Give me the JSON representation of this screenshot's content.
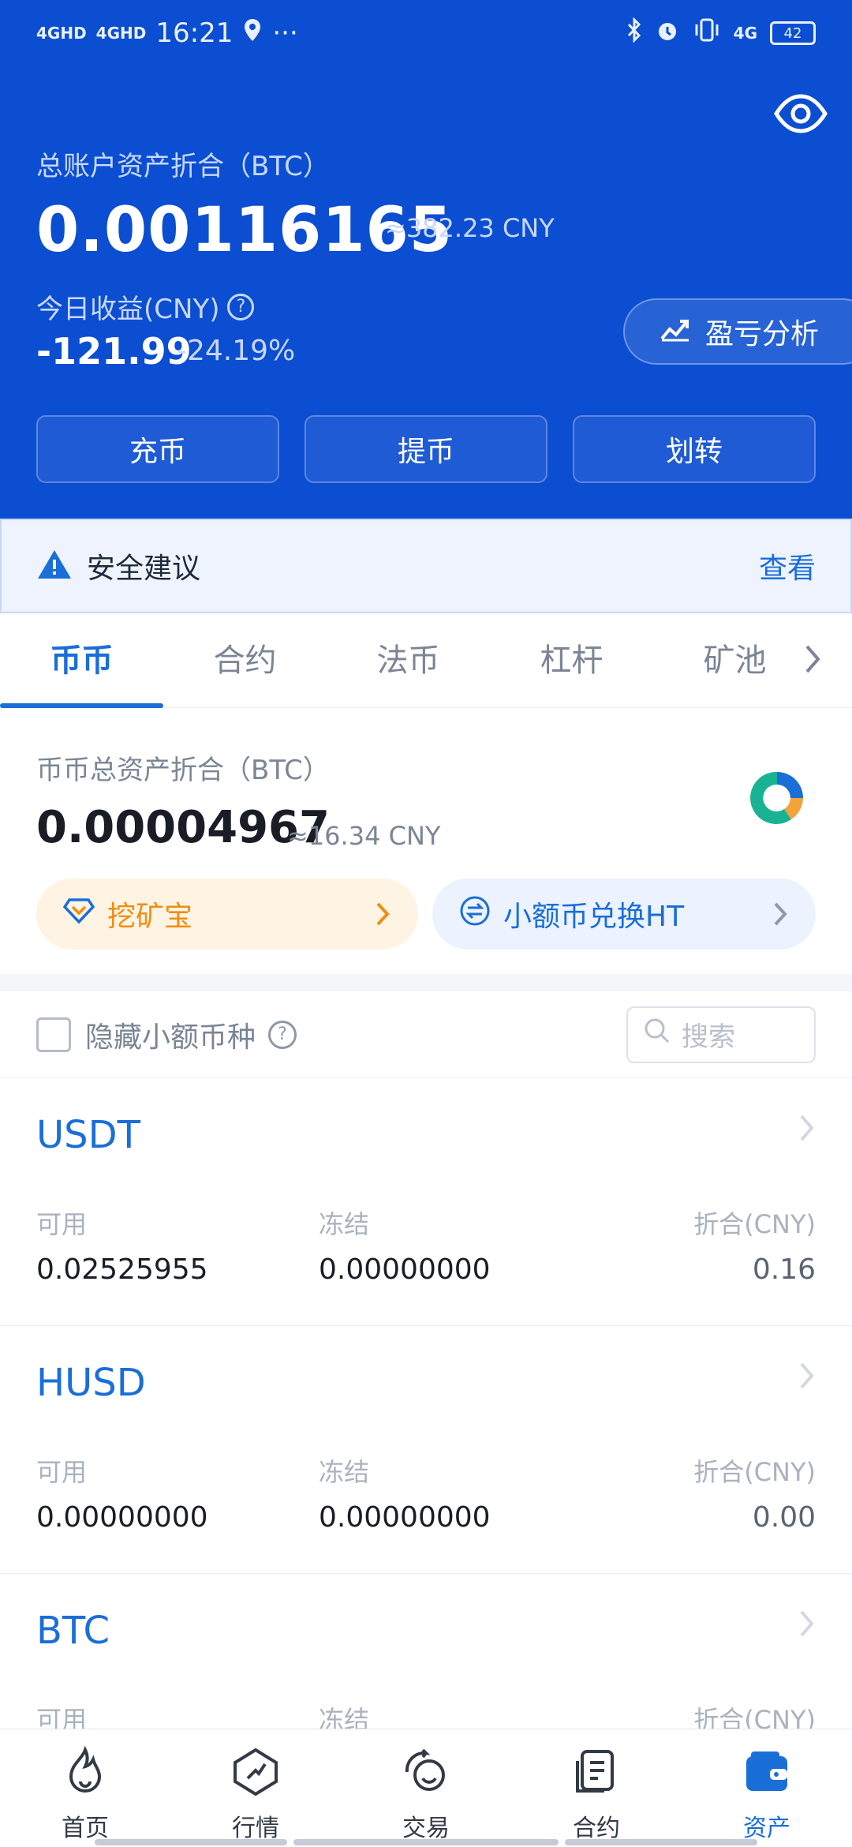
{
  "status_bar": {
    "signal1": "4GHD",
    "signal2": "4GHD",
    "time": "16:21",
    "more": "···",
    "network": "4G",
    "battery": "42"
  },
  "header": {
    "total_label": "总账户资产折合（BTC）",
    "total_btc": "0.00116165",
    "total_cny": "≈382.23 CNY",
    "today_label": "今日收益(CNY)",
    "today_value": "-121.99",
    "today_percent": "-24.19%",
    "pl_button": "盈亏分析",
    "actions": {
      "deposit": "充币",
      "withdraw": "提币",
      "transfer": "划转"
    }
  },
  "security": {
    "label": "安全建议",
    "link": "查看"
  },
  "tabs": [
    {
      "label": "币币"
    },
    {
      "label": "合约"
    },
    {
      "label": "法币"
    },
    {
      "label": "杠杆"
    },
    {
      "label": "矿池"
    }
  ],
  "spot": {
    "label": "币币总资产折合（BTC）",
    "btc": "0.00004967",
    "cny": "≈16.34 CNY",
    "mining_label": "挖矿宝",
    "swap_label": "小额币兑换HT"
  },
  "filter": {
    "hide_small": "隐藏小额币种",
    "search_placeholder": "搜索"
  },
  "columns": {
    "available": "可用",
    "frozen": "冻结",
    "value": "折合(CNY)"
  },
  "coins": [
    {
      "name": "USDT",
      "available": "0.02525955",
      "frozen": "0.00000000",
      "value": "0.16"
    },
    {
      "name": "HUSD",
      "available": "0.00000000",
      "frozen": "0.00000000",
      "value": "0.00"
    },
    {
      "name": "BTC",
      "available": "",
      "frozen": "",
      "value": ""
    }
  ],
  "nav": [
    {
      "label": "首页",
      "icon": "flame-icon"
    },
    {
      "label": "行情",
      "icon": "market-icon"
    },
    {
      "label": "交易",
      "icon": "trade-icon"
    },
    {
      "label": "合约",
      "icon": "contract-icon"
    },
    {
      "label": "资产",
      "icon": "wallet-icon"
    }
  ],
  "colors": {
    "brand_blue": "#0b4ed1",
    "accent": "#1a6ed8",
    "orange": "#ef8d12"
  }
}
